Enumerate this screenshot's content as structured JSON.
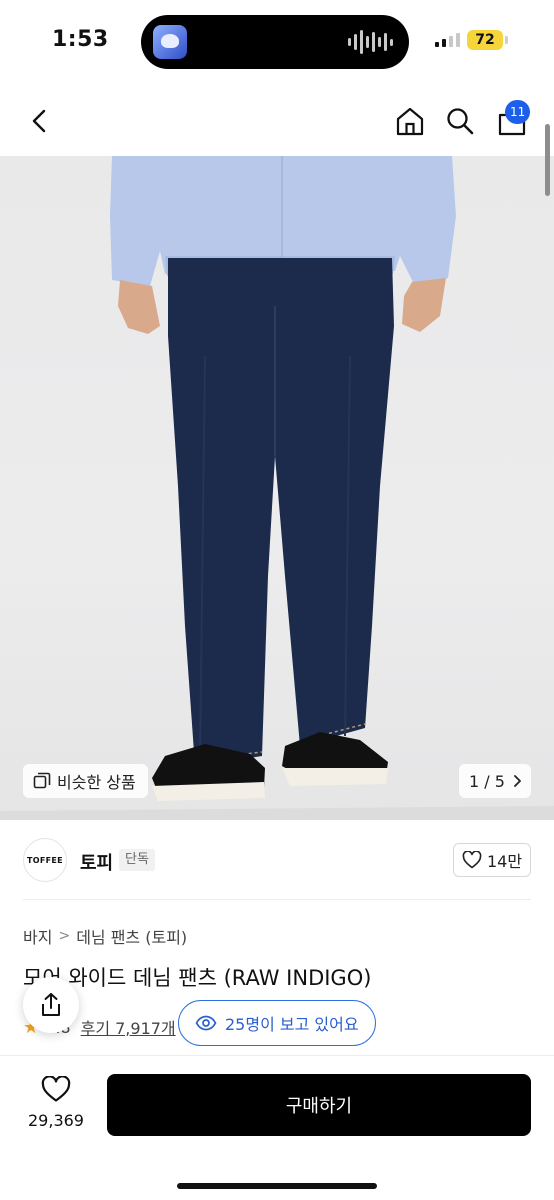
{
  "status_bar": {
    "time": "1:53",
    "battery": "72",
    "signal_bars_active": 2,
    "signal_bars_total": 4
  },
  "nav": {
    "cart_count": "11",
    "icons": [
      "back-icon",
      "home-icon",
      "search-icon",
      "shopping-bag-icon"
    ]
  },
  "gallery": {
    "similar_label": "비슷한 상품",
    "pager": "1 / 5"
  },
  "brand": {
    "logo_text": "TOFFEE",
    "name": "토피",
    "tag": "단독",
    "like_count": "14만"
  },
  "product": {
    "breadcrumb": [
      "바지",
      "데님 팬츠 (토피)"
    ],
    "title": "모어 와이드 데님 팬츠 (RAW INDIGO)",
    "rating": "4.8",
    "review_label": "후기 7,917개",
    "viewers": "25명이 보고 있어요"
  },
  "bottom_bar": {
    "wish_count": "29,369",
    "buy_label": "구매하기"
  },
  "colors": {
    "accent_blue": "#1d5fe8",
    "buy_button": "#000000",
    "star": "#f5a623",
    "battery": "#f6d53a"
  }
}
